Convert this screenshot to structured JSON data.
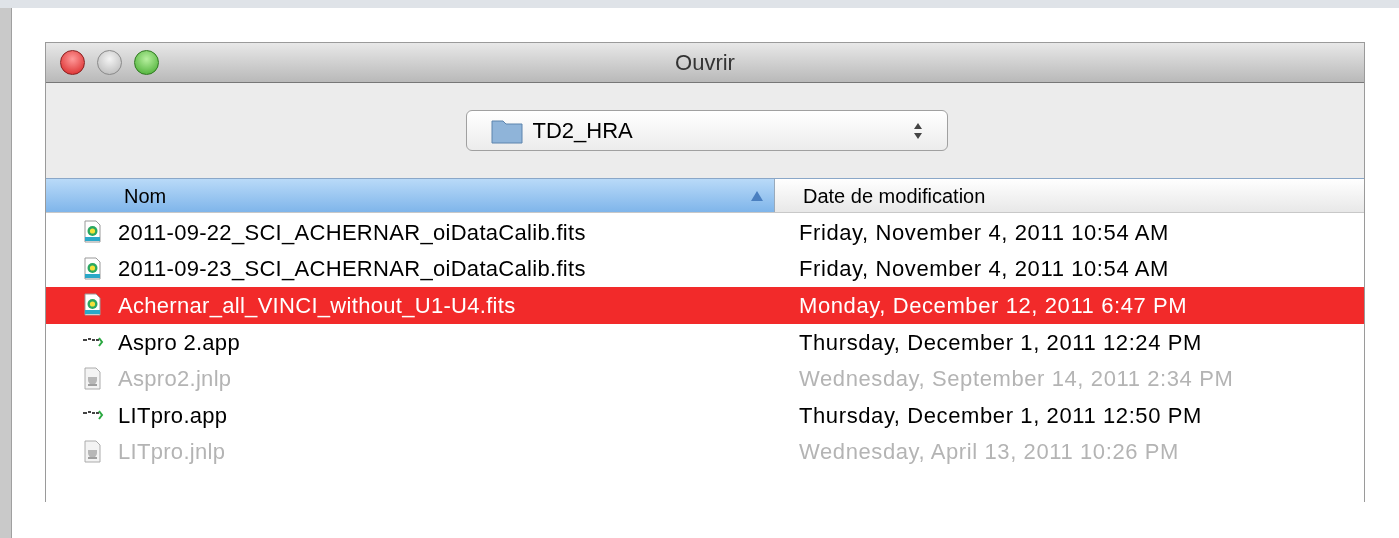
{
  "window": {
    "title": "Ouvrir"
  },
  "location": {
    "folder": "TD2_HRA"
  },
  "table": {
    "columns": [
      {
        "label": "Nom",
        "sorted": true
      },
      {
        "label": "Date de modification",
        "sorted": false
      }
    ],
    "rows": [
      {
        "kind": "fits",
        "name": "2011-09-22_SCI_ACHERNAR_oiDataCalib.fits",
        "date": "Friday, November 4, 2011 10:54 AM",
        "selected": false,
        "disabled": false
      },
      {
        "kind": "fits",
        "name": "2011-09-23_SCI_ACHERNAR_oiDataCalib.fits",
        "date": "Friday, November 4, 2011 10:54 AM",
        "selected": false,
        "disabled": false
      },
      {
        "kind": "fits",
        "name": "Achernar_all_VINCI_without_U1-U4.fits",
        "date": "Monday, December 12, 2011 6:47 PM",
        "selected": true,
        "disabled": false
      },
      {
        "kind": "app",
        "name": "Aspro 2.app",
        "date": "Thursday, December 1, 2011 12:24 PM",
        "selected": false,
        "disabled": false
      },
      {
        "kind": "jnlp",
        "name": "Aspro2.jnlp",
        "date": "Wednesday, September 14, 2011 2:34 PM",
        "selected": false,
        "disabled": true
      },
      {
        "kind": "app",
        "name": "LITpro.app",
        "date": "Thursday, December 1, 2011 12:50 PM",
        "selected": false,
        "disabled": false
      },
      {
        "kind": "jnlp",
        "name": "LITpro.jnlp",
        "date": "Wednesday, April 13, 2011 10:26 PM",
        "selected": false,
        "disabled": true
      }
    ]
  }
}
